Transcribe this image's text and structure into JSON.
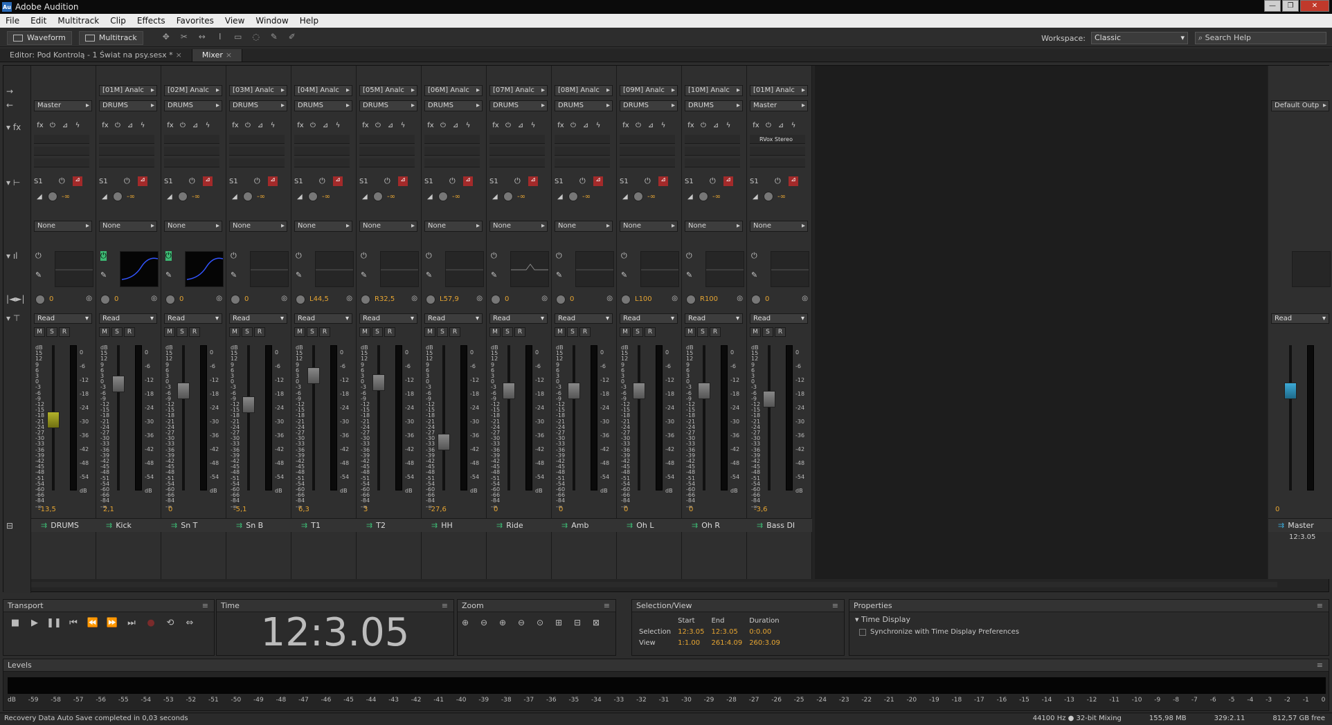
{
  "app": {
    "title": "Adobe Audition",
    "logo": "Au"
  },
  "window_buttons": {
    "minimize": "—",
    "maximize": "❐",
    "close": "✕"
  },
  "menu": [
    "File",
    "Edit",
    "Multitrack",
    "Clip",
    "Effects",
    "Favorites",
    "View",
    "Window",
    "Help"
  ],
  "toolbar": {
    "waveform": "Waveform",
    "multitrack": "Multitrack",
    "workspace_label": "Workspace:",
    "workspace_value": "Classic",
    "search_placeholder": "Search Help"
  },
  "tabs": [
    {
      "label": "Editor: Pod Kontrolą - 1 Świat na psy.sesx *"
    },
    {
      "label": "Mixer"
    }
  ],
  "strips": [
    {
      "name": "DRUMS",
      "input": "",
      "output": "Master",
      "pan": "0",
      "vol": "-13,5",
      "fx": "",
      "eq": "flat"
    },
    {
      "name": "Kick",
      "input": "[01M] Analc",
      "output": "DRUMS",
      "pan": "0",
      "vol": "2,1",
      "fx": "",
      "eq": "curve"
    },
    {
      "name": "Sn T",
      "input": "[02M] Analc",
      "output": "DRUMS",
      "pan": "0",
      "vol": "0",
      "fx": "",
      "eq": "curve"
    },
    {
      "name": "Sn B",
      "input": "[03M] Analc",
      "output": "DRUMS",
      "pan": "0",
      "vol": "-5,1",
      "fx": "",
      "eq": "flat"
    },
    {
      "name": "T1",
      "input": "[04M] Analc",
      "output": "DRUMS",
      "pan": "L44,5",
      "vol": "6,3",
      "fx": "",
      "eq": "flat"
    },
    {
      "name": "T2",
      "input": "[05M] Analc",
      "output": "DRUMS",
      "pan": "R32,5",
      "vol": "3",
      "fx": "",
      "eq": "flat"
    },
    {
      "name": "HH",
      "input": "[06M] Analc",
      "output": "DRUMS",
      "pan": "L57,9",
      "vol": "-27,6",
      "fx": "",
      "eq": "flat"
    },
    {
      "name": "Ride",
      "input": "[07M] Analc",
      "output": "DRUMS",
      "pan": "0",
      "vol": "0",
      "fx": "",
      "eq": "bump"
    },
    {
      "name": "Amb",
      "input": "[08M] Analc",
      "output": "DRUMS",
      "pan": "0",
      "vol": "0",
      "fx": "",
      "eq": "flat"
    },
    {
      "name": "Oh L",
      "input": "[09M] Analc",
      "output": "DRUMS",
      "pan": "L100",
      "vol": "0",
      "fx": "",
      "eq": "flat"
    },
    {
      "name": "Oh R",
      "input": "[10M] Analc",
      "output": "DRUMS",
      "pan": "R100",
      "vol": "0",
      "fx": "",
      "eq": "flat"
    },
    {
      "name": "Bass DI",
      "input": "[01M] Analc",
      "output": "Master",
      "pan": "0",
      "vol": "-3,6",
      "fx": "RVox Stereo",
      "eq": "flat"
    }
  ],
  "master": {
    "name": "Master",
    "output": "Default Outp",
    "vol": "0",
    "time": "12:3.05"
  },
  "common": {
    "send_label": "S1",
    "none": "None",
    "read": "Read",
    "inf": "-∞"
  },
  "scale_left": [
    "dB",
    "15",
    "12",
    "9",
    "6",
    "3",
    "0",
    "-3",
    "-6",
    "-9",
    "-12",
    "-15",
    "-18",
    "-21",
    "-24",
    "-27",
    "-30",
    "-33",
    "-36",
    "-39",
    "-42",
    "-45",
    "-48",
    "-51",
    "-54",
    "-60",
    "-66",
    "-84",
    "-∞"
  ],
  "scale_right": [
    "0",
    "-6",
    "-12",
    "-18",
    "-24",
    "-30",
    "-36",
    "-42",
    "-48",
    "-54",
    "dB"
  ],
  "transport": {
    "title": "Transport",
    "buttons": [
      "■",
      "▶",
      "❚❚",
      "⏮",
      "⏪",
      "⏩",
      "⏭",
      "●",
      "⟲",
      "⇔"
    ]
  },
  "time_panel": {
    "title": "Time",
    "value": "12:3.05"
  },
  "zoom_panel": {
    "title": "Zoom"
  },
  "selection": {
    "title": "Selection/View",
    "headers": [
      "Start",
      "End",
      "Duration"
    ],
    "selection_label": "Selection",
    "view_label": "View",
    "selection": [
      "12:3.05",
      "12:3.05",
      "0:0.00"
    ],
    "view": [
      "1:1.00",
      "261:4.09",
      "260:3.09"
    ]
  },
  "properties": {
    "title": "Properties",
    "section": "Time Display",
    "checkbox": "Synchronize with Time Display Preferences"
  },
  "levels": {
    "title": "Levels",
    "scale": [
      "dB",
      "-59",
      "-58",
      "-57",
      "-56",
      "-55",
      "-54",
      "-53",
      "-52",
      "-51",
      "-50",
      "-49",
      "-48",
      "-47",
      "-46",
      "-45",
      "-44",
      "-43",
      "-42",
      "-41",
      "-40",
      "-39",
      "-38",
      "-37",
      "-36",
      "-35",
      "-34",
      "-33",
      "-32",
      "-31",
      "-30",
      "-29",
      "-28",
      "-27",
      "-26",
      "-25",
      "-24",
      "-23",
      "-22",
      "-21",
      "-20",
      "-19",
      "-18",
      "-17",
      "-16",
      "-15",
      "-14",
      "-13",
      "-12",
      "-11",
      "-10",
      "-9",
      "-8",
      "-7",
      "-6",
      "-5",
      "-4",
      "-3",
      "-2",
      "-1",
      "0"
    ]
  },
  "status": {
    "message": "Recovery Data Auto Save completed in 0,03 seconds",
    "rate": "44100 Hz ● 32-bit Mixing",
    "mem": "155,98 MB",
    "dur": "329:2.11",
    "free": "812,57 GB free"
  },
  "colors": {
    "accent_value": "#e6a532",
    "track_icon": "#3db873"
  }
}
